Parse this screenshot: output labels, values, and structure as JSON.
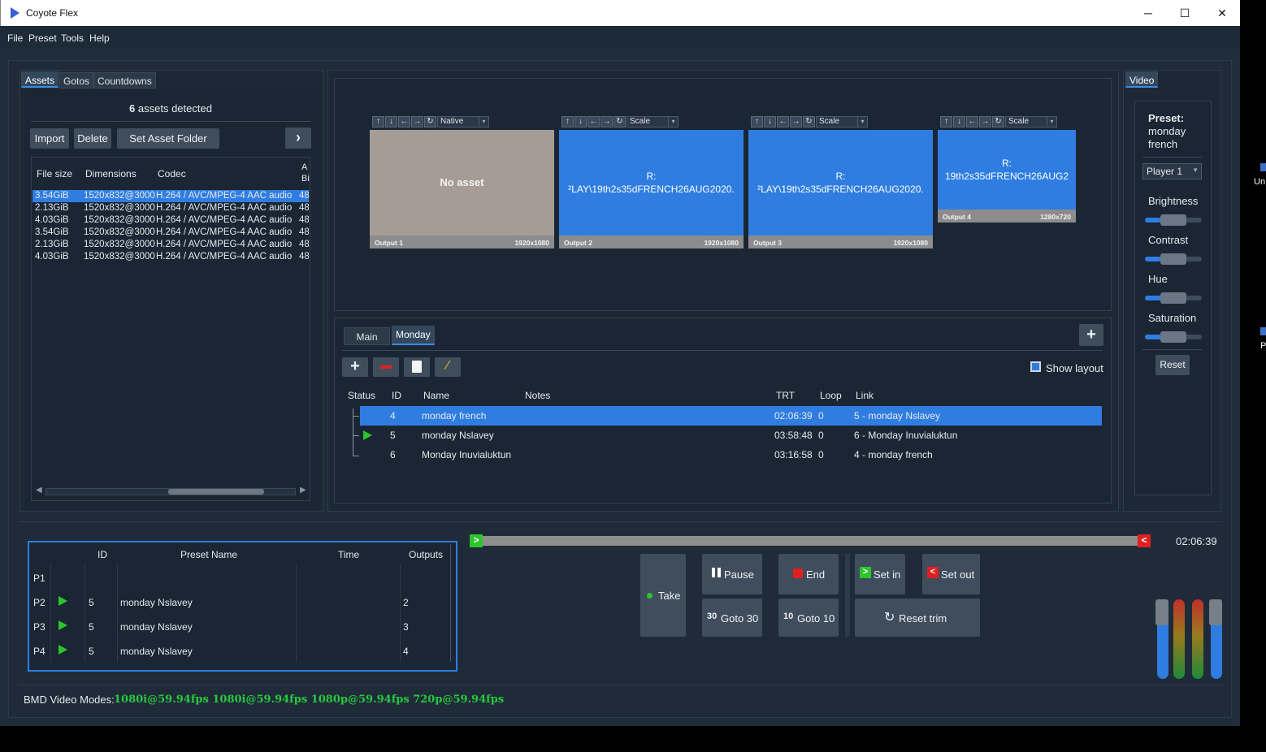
{
  "app": {
    "title": "Coyote Flex"
  },
  "window_controls": {
    "minimize": "─",
    "maximize": "☐",
    "close": "✕"
  },
  "menu": [
    "File",
    "Preset",
    "Tools",
    "Help"
  ],
  "left_tabs": [
    "Assets",
    "Gotos",
    "Countdowns"
  ],
  "assets": {
    "count": "6",
    "detected_label": " assets detected",
    "buttons": {
      "import": "Import",
      "delete": "Delete",
      "set_folder": "Set Asset Folder"
    },
    "columns": [
      "File size",
      "Dimensions",
      "Codec",
      "A",
      "Bi"
    ],
    "rows": [
      {
        "size": "3.54GiB",
        "dims": "1520x832@3000",
        "codec": "H.264 / AVC/MPEG-4 AAC audio",
        "a": "48"
      },
      {
        "size": "2.13GiB",
        "dims": "1520x832@3000",
        "codec": "H.264 / AVC/MPEG-4 AAC audio",
        "a": "48"
      },
      {
        "size": "4.03GiB",
        "dims": "1520x832@3000",
        "codec": "H.264 / AVC/MPEG-4 AAC audio",
        "a": "48"
      },
      {
        "size": "3.54GiB",
        "dims": "1520x832@3000",
        "codec": "H.264 / AVC/MPEG-4 AAC audio",
        "a": "48"
      },
      {
        "size": "2.13GiB",
        "dims": "1520x832@3000",
        "codec": "H.264 / AVC/MPEG-4 AAC audio",
        "a": "48"
      },
      {
        "size": "4.03GiB",
        "dims": "1520x832@3000",
        "codec": "H.264 / AVC/MPEG-4 AAC audio",
        "a": "48"
      }
    ]
  },
  "outputs": [
    {
      "mode": "Native",
      "label": "No asset",
      "sub": "",
      "name": "Output 1",
      "res": "1920x1080",
      "color": "#a59d95"
    },
    {
      "mode": "Scale",
      "label": "R:",
      "sub": "²LAY\\19th2s35dFRENCH26AUG2020.",
      "name": "Output 2",
      "res": "1920x1080",
      "color": "#2f7de1"
    },
    {
      "mode": "Scale",
      "label": "R:",
      "sub": "²LAY\\19th2s35dFRENCH26AUG2020.",
      "name": "Output 3",
      "res": "1920x1080",
      "color": "#2f7de1"
    },
    {
      "mode": "Scale",
      "label": "R:",
      "sub": "19th2s35dFRENCH26AUG2",
      "name": "Output 4",
      "res": "1280x720",
      "color": "#2f7de1"
    }
  ],
  "output_controls": [
    "↑",
    "↓",
    "←",
    "→",
    "↻"
  ],
  "playlist": {
    "tabs": [
      "Main",
      "Monday"
    ],
    "show_layout": "Show layout",
    "columns": [
      "Status",
      "ID",
      "Name",
      "Notes",
      "TRT",
      "Loop",
      "Link"
    ],
    "rows": [
      {
        "id": "4",
        "name": "monday french",
        "notes": "",
        "trt": "02:06:39",
        "loop": "0",
        "link": "5 - monday Nslavey",
        "playing": false,
        "selected": true
      },
      {
        "id": "5",
        "name": "monday Nslavey",
        "notes": "",
        "trt": "03:58:48",
        "loop": "0",
        "link": "6 - Monday Inuvialuktun",
        "playing": true,
        "selected": false
      },
      {
        "id": "6",
        "name": "Monday Inuvialuktun",
        "notes": "",
        "trt": "03:16:58",
        "loop": "0",
        "link": "4 - monday french",
        "playing": false,
        "selected": false
      }
    ]
  },
  "presets": {
    "columns": [
      "ID",
      "Preset Name",
      "Time",
      "Outputs"
    ],
    "rows": [
      {
        "p": "P1",
        "id": "",
        "name": "",
        "time": "",
        "outputs": "",
        "playing": false
      },
      {
        "p": "P2",
        "id": "5",
        "name": "monday Nslavey",
        "time": "",
        "outputs": "2",
        "playing": true
      },
      {
        "p": "P3",
        "id": "5",
        "name": "monday Nslavey",
        "time": "",
        "outputs": "3",
        "playing": true
      },
      {
        "p": "P4",
        "id": "5",
        "name": "monday Nslavey",
        "time": "",
        "outputs": "4",
        "playing": true
      }
    ]
  },
  "transport": {
    "time": "02:06:39",
    "take": "Take",
    "pause": "Pause",
    "end": "End",
    "set_in": "Set in",
    "set_out": "Set out",
    "goto30_num": "30",
    "goto30": "Goto 30",
    "goto10_num": "10",
    "goto10": "Goto 10",
    "reset_trim": "Reset trim"
  },
  "video": {
    "tab": "Video",
    "preset_label": "Preset:",
    "preset_name_1": "monday",
    "preset_name_2": "french",
    "player": "Player 1",
    "brightness": "Brightness",
    "contrast": "Contrast",
    "hue": "Hue",
    "saturation": "Saturation",
    "reset": "Reset"
  },
  "status": {
    "label": "BMD Video Modes:",
    "modes": "1080i@59.94fps 1080i@59.94fps 1080p@59.94fps 720p@59.94fps"
  },
  "edge": {
    "text1": "Un",
    "text2": "P"
  },
  "colors": {
    "accent": "#2f7de1",
    "play_green": "#2cc52c",
    "status_green": "#27c93f",
    "end_red": "#e02020"
  }
}
